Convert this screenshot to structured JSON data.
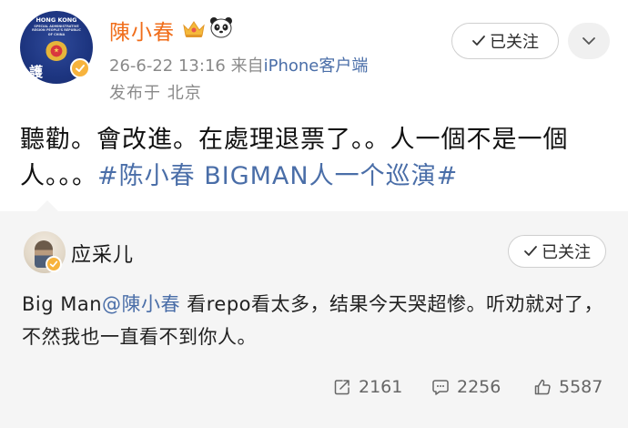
{
  "post": {
    "author": {
      "name": "陳小春",
      "avatar_text_top": "HONG KONG",
      "avatar_text_sub": "SPECIAL ADMINISTRATIVE REGION PEOPLE'S REPUBLIC OF CHINA",
      "avatar_glyph": "護"
    },
    "timestamp": "26-6-22 13:16",
    "source_prefix": "来自",
    "source_client": "iPhone客户端",
    "location": "发布于 北京",
    "follow_label": "已关注",
    "text_main": "聽勸。會改進。在處理退票了。。人一個不是一個人。。。",
    "hashtag": "#陈小春 BIGMAN人一个巡演#"
  },
  "retweet": {
    "author": {
      "name": "应采儿"
    },
    "follow_label": "已关注",
    "text_prefix": "Big Man",
    "mention": "@陳小春",
    "text_rest": " 看repo看太多，结果今天哭超惨。听劝就对了，不然我也一直看不到你人。",
    "stats": {
      "reposts": "2161",
      "comments": "2256",
      "likes": "5587"
    }
  },
  "colors": {
    "username": "#f06d1a",
    "link": "#4a6ea8",
    "badge": "#f7b33d",
    "card_bg": "#f5f5f5"
  },
  "icons": [
    "crown-icon",
    "panda-icon",
    "verified-badge-icon",
    "check-icon",
    "chevron-down-icon",
    "repost-icon",
    "comment-icon",
    "like-icon"
  ]
}
